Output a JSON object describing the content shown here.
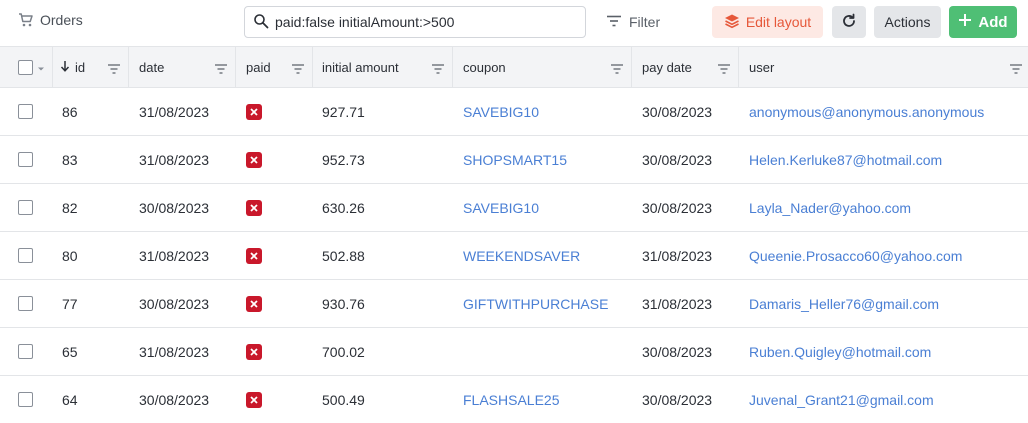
{
  "header": {
    "title": "Orders",
    "search_value": "paid:false initialAmount:>500",
    "filter_label": "Filter",
    "edit_layout_label": "Edit layout",
    "actions_label": "Actions",
    "add_label": "Add"
  },
  "columns": {
    "id": "id",
    "date": "date",
    "paid": "paid",
    "initial_amount": "initial amount",
    "coupon": "coupon",
    "pay_date": "pay date",
    "user": "user"
  },
  "rows": [
    {
      "id": "86",
      "date": "31/08/2023",
      "paid": false,
      "initial_amount": "927.71",
      "coupon": "SAVEBIG10",
      "pay_date": "30/08/2023",
      "user": "anonymous@anonymous.anonymous"
    },
    {
      "id": "83",
      "date": "31/08/2023",
      "paid": false,
      "initial_amount": "952.73",
      "coupon": "SHOPSMART15",
      "pay_date": "30/08/2023",
      "user": "Helen.Kerluke87@hotmail.com"
    },
    {
      "id": "82",
      "date": "30/08/2023",
      "paid": false,
      "initial_amount": "630.26",
      "coupon": "SAVEBIG10",
      "pay_date": "30/08/2023",
      "user": "Layla_Nader@yahoo.com"
    },
    {
      "id": "80",
      "date": "31/08/2023",
      "paid": false,
      "initial_amount": "502.88",
      "coupon": "WEEKENDSAVER",
      "pay_date": "31/08/2023",
      "user": "Queenie.Prosacco60@yahoo.com"
    },
    {
      "id": "77",
      "date": "30/08/2023",
      "paid": false,
      "initial_amount": "930.76",
      "coupon": "GIFTWITHPURCHASE",
      "pay_date": "31/08/2023",
      "user": "Damaris_Heller76@gmail.com"
    },
    {
      "id": "65",
      "date": "31/08/2023",
      "paid": false,
      "initial_amount": "700.02",
      "coupon": "",
      "pay_date": "30/08/2023",
      "user": "Ruben.Quigley@hotmail.com"
    },
    {
      "id": "64",
      "date": "30/08/2023",
      "paid": false,
      "initial_amount": "500.49",
      "coupon": "FLASHSALE25",
      "pay_date": "30/08/2023",
      "user": "Juvenal_Grant21@gmail.com"
    }
  ],
  "colors": {
    "accent_link": "#4a7fd4",
    "add_green": "#4fbf75",
    "edit_orange": "#e6583a",
    "unpaid_red": "#c9182b"
  },
  "icons": {
    "title": "cart-icon",
    "search": "search-icon",
    "filter": "filter-lines-icon",
    "edit_layout": "layers-icon",
    "refresh": "refresh-icon",
    "add": "plus-icon",
    "sort": "arrow-down-icon",
    "paid_false": "x-square-icon"
  }
}
